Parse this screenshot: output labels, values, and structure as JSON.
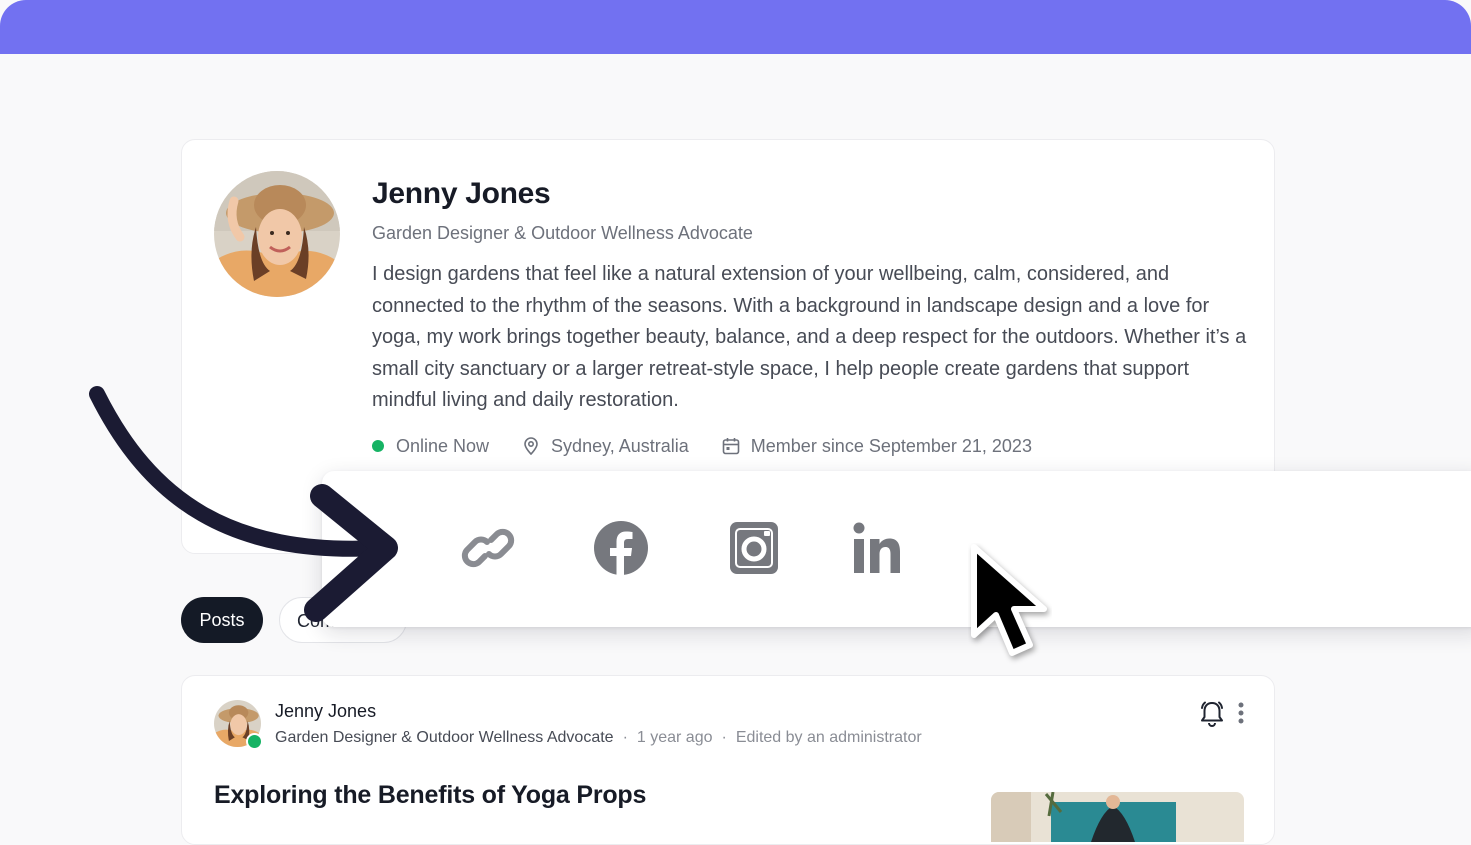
{
  "colors": {
    "top_bar": "#7271f1",
    "online": "#16b364",
    "tab_active_bg": "#141a26"
  },
  "profile": {
    "name": "Jenny Jones",
    "subtitle": "Garden Designer & Outdoor Wellness Advocate",
    "bio": "I design gardens that feel like a natural extension of your wellbeing, calm, considered, and connected to the rhythm of the seasons. With a background in landscape design and a love for yoga, my work brings together beauty, balance, and a deep respect for the outdoors. Whether it’s a small city sanctuary or a larger retreat-style space, I help people create gardens that support mindful living and daily restoration.",
    "status": "Online Now",
    "location": "Sydney, Australia",
    "member_since": "Member since September 21, 2023"
  },
  "social_links": [
    {
      "icon": "link-icon"
    },
    {
      "icon": "facebook-icon"
    },
    {
      "icon": "instagram-icon"
    },
    {
      "icon": "linkedin-icon"
    }
  ],
  "tabs": [
    {
      "label": "Posts",
      "active": true
    },
    {
      "label": "Comments",
      "active": false
    }
  ],
  "post": {
    "author": "Jenny Jones",
    "role": "Garden Designer & Outdoor Wellness Advocate",
    "time": "1 year ago",
    "edited": "Edited by an administrator",
    "title": "Exploring the Benefits of Yoga Props"
  }
}
